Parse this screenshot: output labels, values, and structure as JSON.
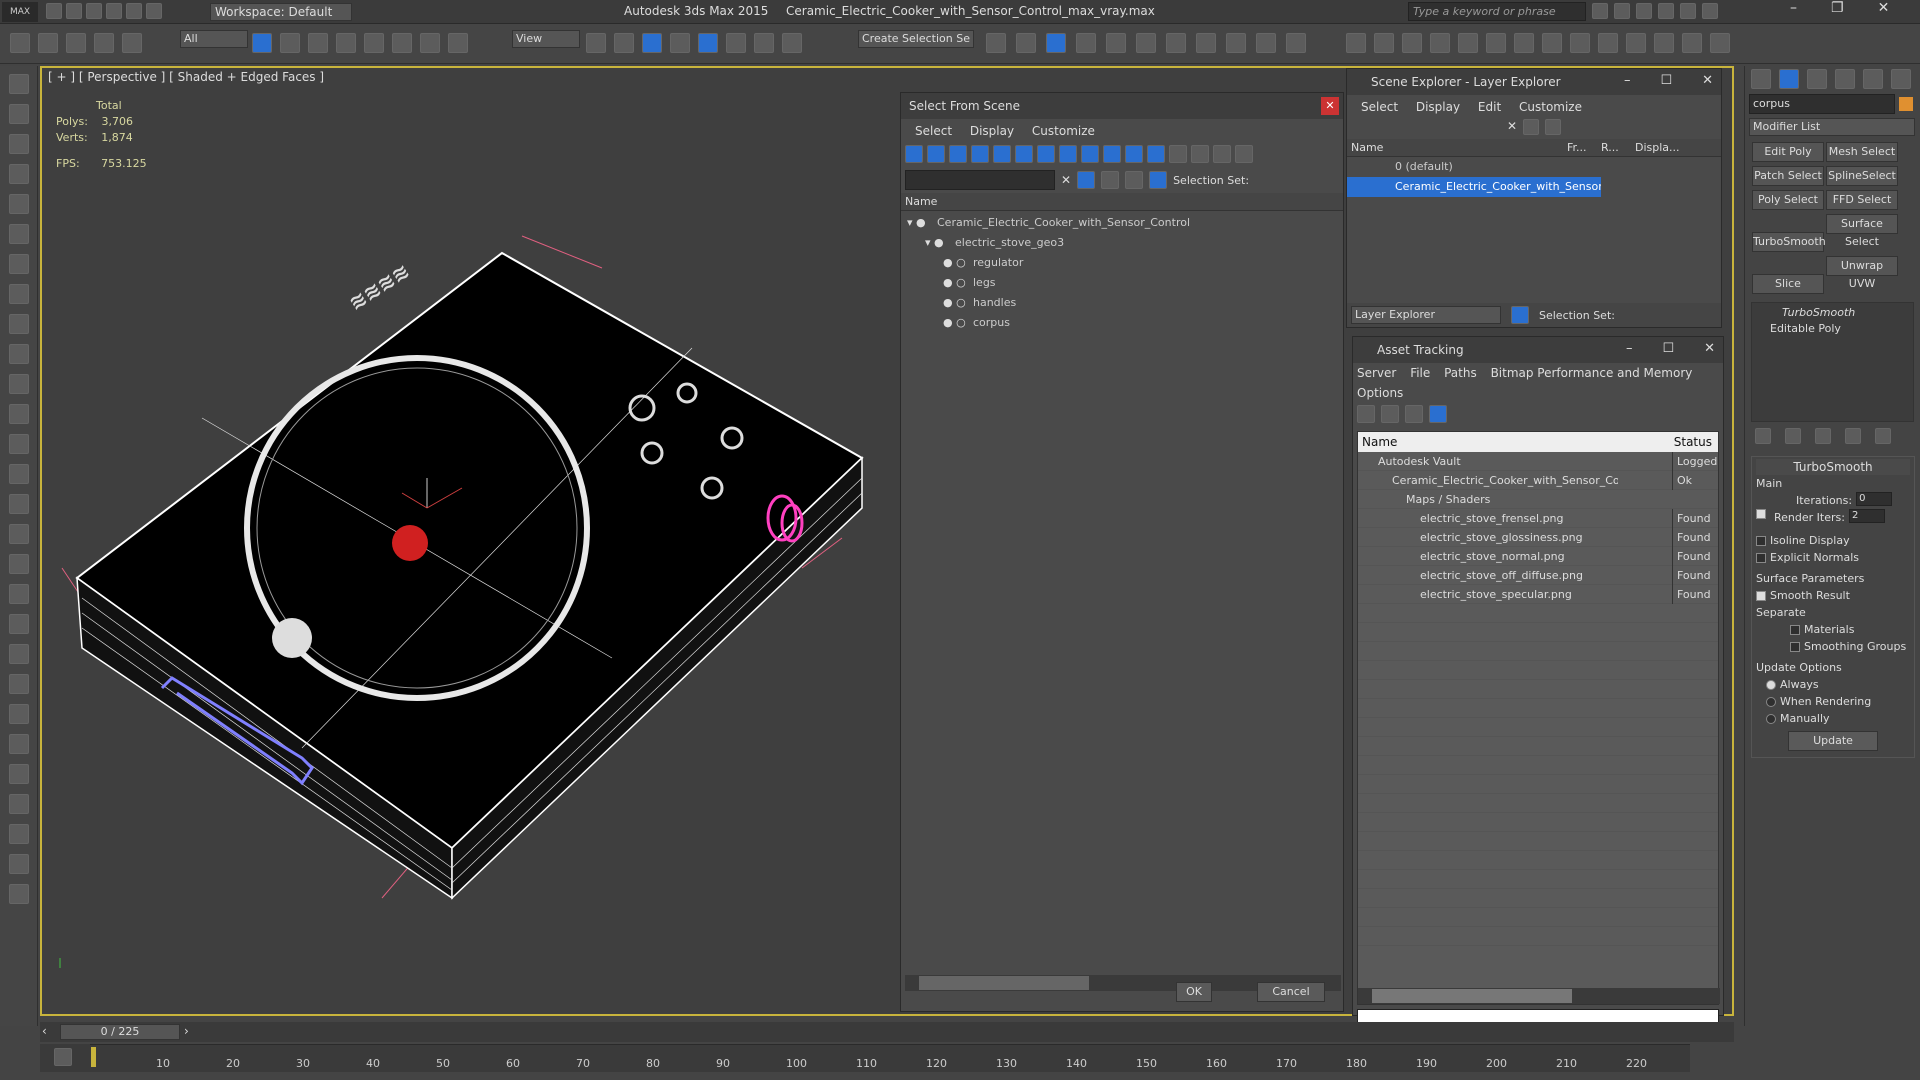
{
  "app": {
    "title": "Autodesk 3ds Max  2015",
    "file": "Ceramic_Electric_Cooker_with_Sensor_Control_max_vray.max",
    "workspace": "Workspace: Default",
    "search_placeholder": "Type a keyword or phrase",
    "filter_dropdown": "All",
    "view_dropdown": "View",
    "selection_set_dropdown": "Create Selection Se"
  },
  "viewport": {
    "label": "[ + ] [ Perspective ] [ Shaded + Edged Faces ]",
    "stats_header": "Total",
    "polys_label": "Polys:",
    "polys": "3,706",
    "verts_label": "Verts:",
    "verts": "1,874",
    "fps_label": "FPS:",
    "fps": "753.125"
  },
  "select_from_scene": {
    "title": "Select From Scene",
    "menu": [
      "Select",
      "Display",
      "Customize"
    ],
    "selection_set_label": "Selection Set:",
    "column_name": "Name",
    "tree": [
      {
        "label": "Ceramic_Electric_Cooker_with_Sensor_Control",
        "level": 0
      },
      {
        "label": "electric_stove_geo3",
        "level": 1
      },
      {
        "label": "regulator",
        "level": 2
      },
      {
        "label": "legs",
        "level": 2
      },
      {
        "label": "handles",
        "level": 2
      },
      {
        "label": "corpus",
        "level": 2
      }
    ],
    "ok": "OK",
    "cancel": "Cancel"
  },
  "scene_explorer": {
    "title": "Scene Explorer - Layer Explorer",
    "menu": [
      "Select",
      "Display",
      "Edit",
      "Customize"
    ],
    "columns": [
      "Name",
      "Fr...",
      "R...",
      "Displa..."
    ],
    "rows": [
      "0 (default)",
      "Ceramic_Electric_Cooker_with_Sensor_..."
    ],
    "footer_dropdown": "Layer Explorer",
    "selection_set_label": "Selection Set:"
  },
  "asset_tracking": {
    "title": "Asset Tracking",
    "menu": [
      "Server",
      "File",
      "Paths",
      "Bitmap Performance and Memory",
      "Options"
    ],
    "columns": [
      "Name",
      "Status"
    ],
    "rows": [
      {
        "name": "Autodesk Vault",
        "status": "Logged",
        "level": 0
      },
      {
        "name": "Ceramic_Electric_Cooker_with_Sensor_Control_...",
        "status": "Ok",
        "level": 1
      },
      {
        "name": "Maps / Shaders",
        "status": "",
        "level": 2
      },
      {
        "name": "electric_stove_frensel.png",
        "status": "Found",
        "level": 3
      },
      {
        "name": "electric_stove_glossiness.png",
        "status": "Found",
        "level": 3
      },
      {
        "name": "electric_stove_normal.png",
        "status": "Found",
        "level": 3
      },
      {
        "name": "electric_stove_off_diffuse.png",
        "status": "Found",
        "level": 3
      },
      {
        "name": "electric_stove_specular.png",
        "status": "Found",
        "level": 3
      }
    ]
  },
  "command_panel": {
    "object_name": "corpus",
    "modifier_list": "Modifier List",
    "buttons": [
      "Edit Poly",
      "Mesh Select",
      "Patch Select",
      "SplineSelect",
      "Poly Select",
      "FFD Select",
      "TurboSmooth",
      "Surface Select",
      "Slice",
      "Unwrap UVW"
    ],
    "stack": [
      "TurboSmooth",
      "Editable Poly"
    ],
    "rollout_title": "TurboSmooth",
    "main_label": "Main",
    "iterations_label": "Iterations:",
    "iterations": "0",
    "render_iters_label": "Render Iters:",
    "render_iters": "2",
    "isoline": "Isoline Display",
    "explicit_normals": "Explicit Normals",
    "surface_params": "Surface Parameters",
    "smooth_result": "Smooth Result",
    "separate": "Separate",
    "materials": "Materials",
    "smoothing_groups": "Smoothing Groups",
    "update_options": "Update Options",
    "always": "Always",
    "when_rendering": "When Rendering",
    "manually": "Manually",
    "update": "Update"
  },
  "timeline": {
    "frame": "0 / 225",
    "ticks": [
      "10",
      "20",
      "30",
      "40",
      "50",
      "60",
      "70",
      "80",
      "90",
      "100",
      "110",
      "120",
      "130",
      "140",
      "150",
      "160",
      "170",
      "180",
      "190",
      "200",
      "210",
      "220"
    ]
  },
  "colors": {
    "accent": "#c8b43c",
    "selection": "#2a6fd0",
    "wire": "#ffffff"
  }
}
